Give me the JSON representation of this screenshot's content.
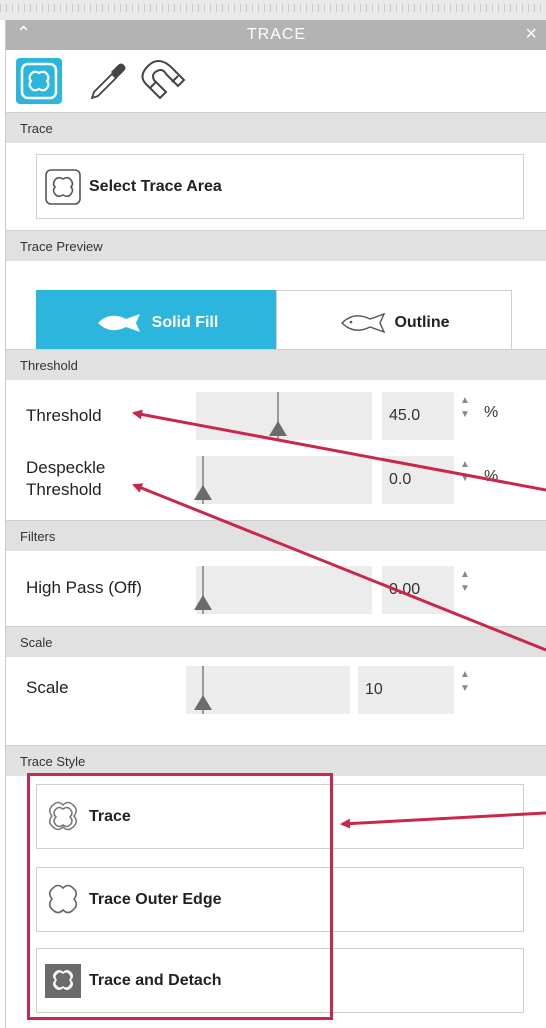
{
  "window": {
    "title": "TRACE",
    "collapse_icon": "chevron-up-icon",
    "close_icon": "close-icon"
  },
  "toolbar": {
    "tools": [
      "trace-shape-icon",
      "eyedropper-icon",
      "magnet-icon"
    ],
    "active": "trace-shape-icon"
  },
  "sections": {
    "trace": {
      "header": "Trace",
      "button_label": "Select Trace Area"
    },
    "preview": {
      "header": "Trace Preview",
      "solid_label": "Solid Fill",
      "outline_label": "Outline",
      "selected": "Solid Fill"
    },
    "threshold": {
      "header": "Threshold",
      "threshold_label": "Threshold",
      "threshold_value": "45.0",
      "threshold_unit": "%",
      "threshold_level": 0.45,
      "despeckle_label_1": "Despeckle",
      "despeckle_label_2": "Threshold",
      "despeckle_value": "0.0",
      "despeckle_unit": "%",
      "despeckle_level": 0.0
    },
    "filters": {
      "header": "Filters",
      "highpass_label": "High Pass (Off)",
      "highpass_value": "0.00",
      "highpass_level": 0.0
    },
    "scale": {
      "header": "Scale",
      "scale_label": "Scale",
      "scale_value": "10",
      "scale_level": 0.0
    },
    "style": {
      "header": "Trace Style",
      "trace_label": "Trace",
      "outer_label": "Trace Outer Edge",
      "detach_label": "Trace and Detach"
    }
  },
  "colors": {
    "accent": "#2cb6dd",
    "titlebar": "#b3b3b3",
    "annotation": "#c8284b"
  }
}
